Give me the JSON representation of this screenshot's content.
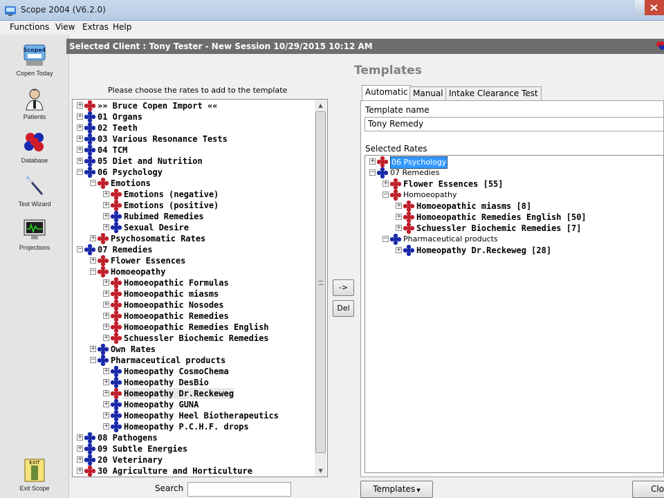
{
  "window": {
    "title": "Scope 2004 (V6.2.0)"
  },
  "menu": [
    "Functions",
    "View",
    "Extras",
    "Help"
  ],
  "sidebar": [
    {
      "label": "Copen Today",
      "icon": "scope-icon"
    },
    {
      "label": "Patients",
      "icon": "patient-icon"
    },
    {
      "label": "Database",
      "icon": "molecule-icon"
    },
    {
      "label": "Test Wizard",
      "icon": "wand-icon"
    },
    {
      "label": "Projections",
      "icon": "monitor-icon"
    }
  ],
  "exit": {
    "label": "Exit Scope",
    "icon_text": "EXIT"
  },
  "client_bar": "Selected Client :  Tony Tester - New Session 10/29/2015 10:12 AM",
  "heading": "Templates",
  "instruction": "Please choose the rates to add to the template",
  "left_tree": [
    {
      "label": "»» Bruce Copen Import ««",
      "level": 0,
      "color": "red"
    },
    {
      "label": "01 Organs",
      "level": 0,
      "color": "blue"
    },
    {
      "label": "02 Teeth",
      "level": 0,
      "color": "blue"
    },
    {
      "label": "03 Various Resonance Tests",
      "level": 0,
      "color": "blue"
    },
    {
      "label": "04 TCM",
      "level": 0,
      "color": "blue"
    },
    {
      "label": "05 Diet and Nutrition",
      "level": 0,
      "color": "blue"
    },
    {
      "label": "06 Psychology",
      "level": 0,
      "color": "blue",
      "expanded": true
    },
    {
      "label": "Emotions",
      "level": 1,
      "color": "red",
      "expanded": true
    },
    {
      "label": "Emotions (negative)",
      "level": 2,
      "color": "red"
    },
    {
      "label": "Emotions (positive)",
      "level": 2,
      "color": "red"
    },
    {
      "label": "Rubimed Remedies",
      "level": 2,
      "color": "blue"
    },
    {
      "label": "Sexual Desire",
      "level": 2,
      "color": "blue"
    },
    {
      "label": "Psychosomatic Rates",
      "level": 1,
      "color": "red"
    },
    {
      "label": "07 Remedies",
      "level": 0,
      "color": "blue",
      "expanded": true
    },
    {
      "label": "Flower Essences",
      "level": 1,
      "color": "red"
    },
    {
      "label": "Homoeopathy",
      "level": 1,
      "color": "red",
      "expanded": true
    },
    {
      "label": "Homoeopathic Formulas",
      "level": 2,
      "color": "red"
    },
    {
      "label": "Homoeopathic miasms",
      "level": 2,
      "color": "red"
    },
    {
      "label": "Homoeopathic Nosodes",
      "level": 2,
      "color": "red"
    },
    {
      "label": "Homoeopathic Remedies",
      "level": 2,
      "color": "red"
    },
    {
      "label": "Homoeopathic Remedies English",
      "level": 2,
      "color": "red"
    },
    {
      "label": "Schuessler Biochemic Remedies",
      "level": 2,
      "color": "red"
    },
    {
      "label": "Own Rates",
      "level": 1,
      "color": "blue"
    },
    {
      "label": "Pharmaceutical products",
      "level": 1,
      "color": "blue",
      "expanded": true
    },
    {
      "label": "Homeopathy CosmoChema",
      "level": 2,
      "color": "blue"
    },
    {
      "label": "Homeopathy DesBio",
      "level": 2,
      "color": "blue"
    },
    {
      "label": "Homeopathy Dr.Reckeweg",
      "level": 2,
      "color": "red",
      "highlight": true
    },
    {
      "label": "Homeopathy GUNA",
      "level": 2,
      "color": "blue"
    },
    {
      "label": "Homeopathy Heel Biotherapeutics",
      "level": 2,
      "color": "blue"
    },
    {
      "label": "Homeopathy P.C.H.F. drops",
      "level": 2,
      "color": "blue"
    },
    {
      "label": "08 Pathogens",
      "level": 0,
      "color": "blue"
    },
    {
      "label": "09 Subtle Energies",
      "level": 0,
      "color": "blue"
    },
    {
      "label": "20 Veterinary",
      "level": 0,
      "color": "blue"
    },
    {
      "label": "30 Agriculture and Horticulture",
      "level": 0,
      "color": "red"
    }
  ],
  "buttons": {
    "add": "->",
    "del": "Del",
    "templates": "Templates",
    "close": "Clo"
  },
  "tabs": [
    "Automatic",
    "Manual",
    "Intake Clearance Test"
  ],
  "template_name": {
    "label": "Template name",
    "value": "Tony Remedy"
  },
  "selected_rates": {
    "label": "Selected Rates"
  },
  "right_tree": [
    {
      "label": "06 Psychology",
      "level": 0,
      "color": "red",
      "plain": true,
      "selected": true
    },
    {
      "label": "07 Remedies",
      "level": 0,
      "color": "blue",
      "plain": true,
      "expanded": true
    },
    {
      "label": "Flower Essences [55]",
      "level": 1,
      "color": "red"
    },
    {
      "label": "Homoeopathy",
      "level": 1,
      "color": "red",
      "plain": true,
      "expanded": true
    },
    {
      "label": "Homoeopathic miasms [8]",
      "level": 2,
      "color": "red"
    },
    {
      "label": "Homoeopathic Remedies English [50]",
      "level": 2,
      "color": "red"
    },
    {
      "label": "Schuessler Biochemic Remedies [7]",
      "level": 2,
      "color": "red"
    },
    {
      "label": "Pharmaceutical products",
      "level": 1,
      "color": "blue",
      "plain": true,
      "expanded": true
    },
    {
      "label": "Homeopathy Dr.Reckeweg [28]",
      "level": 2,
      "color": "blue"
    }
  ],
  "search": {
    "label": "Search",
    "value": ""
  },
  "colors": {
    "red_node": "#c0202c",
    "blue_node": "#1a2aa8",
    "client_bar": "#6e6e6e",
    "selection": "#3399ff"
  }
}
